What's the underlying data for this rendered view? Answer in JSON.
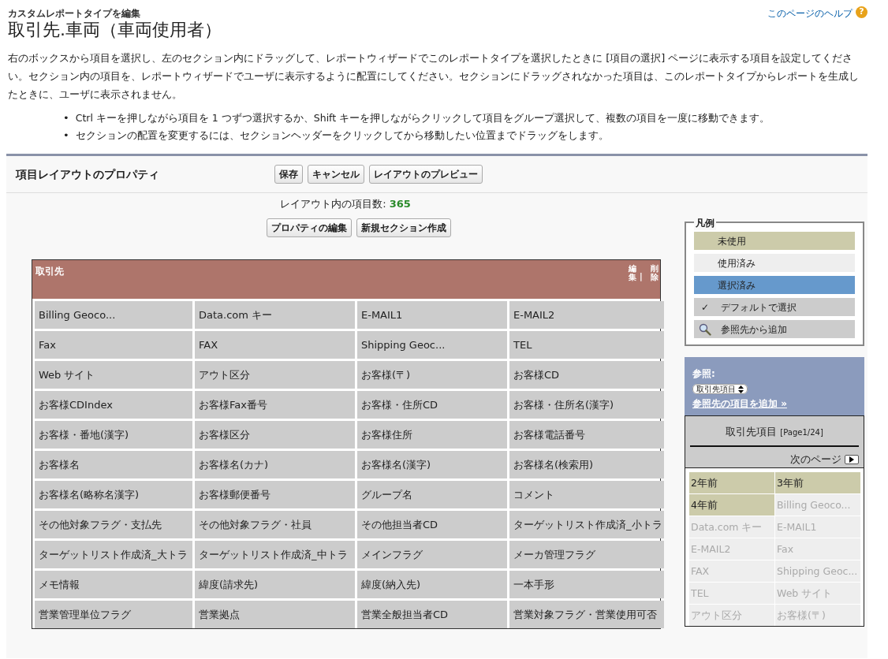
{
  "breadcrumb": "カスタムレポートタイプを編集",
  "title": "取引先.車両（車両使用者）",
  "help_link": "このページのヘルプ",
  "help_icon": "?",
  "description": "右のボックスから項目を選択し、左のセクション内にドラッグして、レポートウィザードでこのレポートタイプを選択したときに [項目の選択] ページに表示する項目を設定してください。セクション内の項目を、レポートウィザードでユーザに表示するように配置にしてください。セクションにドラッグされなかった項目は、このレポートタイプからレポートを生成したときに、ユーザに表示されません。",
  "tips": [
    {
      "marker": "•",
      "text": "Ctrl キーを押しながら項目を 1 つずつ選択するか、Shift キーを押しながらクリックして項目をグループ選択して、複数の項目を一度に移動できます。"
    },
    {
      "marker": "•",
      "text": "セクションの配置を変更するには、セクションヘッダーをクリックしてから移動したい位置までドラッグをします。"
    }
  ],
  "panel": {
    "title": "項目レイアウトのプロパティ",
    "buttons": [
      "保存",
      "キャンセル",
      "レイアウトのプレビュー"
    ],
    "count_label": "レイアウト内の項目数:",
    "count": "365",
    "actions": [
      "プロパティの編集",
      "新規セクション作成"
    ]
  },
  "section": {
    "title": "取引先",
    "edit_link": "編集",
    "separator": "|",
    "delete_link": "削除",
    "fields": [
      [
        "Billing Geoco...",
        "Data.com キー",
        "E-MAIL1",
        "E-MAIL2"
      ],
      [
        "Fax",
        "FAX",
        "Shipping Geoc...",
        "TEL"
      ],
      [
        "Web サイト",
        "アウト区分",
        "お客様(〒)",
        "お客様CD"
      ],
      [
        "お客様CDIndex",
        "お客様Fax番号",
        "お客様・住所CD",
        "お客様・住所名(漢字)"
      ],
      [
        "お客様・番地(漢字)",
        "お客様区分",
        "お客様住所",
        "お客様電話番号"
      ],
      [
        "お客様名",
        "お客様名(カナ)",
        "お客様名(漢字)",
        "お客様名(検索用)"
      ],
      [
        "お客様名(略称名漢字)",
        "お客様郵便番号",
        "グループ名",
        "コメント"
      ],
      [
        "その他対象フラグ・支払先",
        "その他対象フラグ・社員",
        "その他担当者CD",
        "ターゲットリスト作成済_小トラ"
      ],
      [
        "ターゲットリスト作成済_大トラ",
        "ターゲットリスト作成済_中トラ",
        "メインフラグ",
        "メーカ管理フラグ"
      ],
      [
        "メモ情報",
        "緯度(請求先)",
        "緯度(納入先)",
        "一本手形"
      ],
      [
        "営業管理単位フラグ",
        "営業拠点",
        "営業全般担当者CD",
        "営業対象フラグ・営業使用可否"
      ]
    ]
  },
  "legend": {
    "title": "凡例",
    "items": [
      {
        "kind": "unused",
        "label": "未使用"
      },
      {
        "kind": "used",
        "label": "使用済み"
      },
      {
        "kind": "selected",
        "label": "選択済み"
      },
      {
        "kind": "default",
        "icon": "✓",
        "label": "デフォルトで選択"
      },
      {
        "kind": "lookup",
        "label": "参照先から追加"
      }
    ]
  },
  "reference": {
    "label": "参照:",
    "select": "取引先項目",
    "add_link": "参照先の項目を追加 »"
  },
  "field_list": {
    "title": "取引先項目",
    "page": "[Page1/24]",
    "next": "次のページ",
    "items": [
      {
        "label": "2年前",
        "used": false
      },
      {
        "label": "3年前",
        "used": false
      },
      {
        "label": "4年前",
        "used": false
      },
      {
        "label": "Billing Geoco...",
        "used": true
      },
      {
        "label": "Data.com キー",
        "used": true
      },
      {
        "label": "E-MAIL1",
        "used": true
      },
      {
        "label": "E-MAIL2",
        "used": true
      },
      {
        "label": "Fax",
        "used": true
      },
      {
        "label": "FAX",
        "used": true
      },
      {
        "label": "Shipping Geoc...",
        "used": true
      },
      {
        "label": "TEL",
        "used": true
      },
      {
        "label": "Web サイト",
        "used": true
      },
      {
        "label": "アウト区分",
        "used": true
      },
      {
        "label": "お客様(〒)",
        "used": true
      }
    ]
  }
}
